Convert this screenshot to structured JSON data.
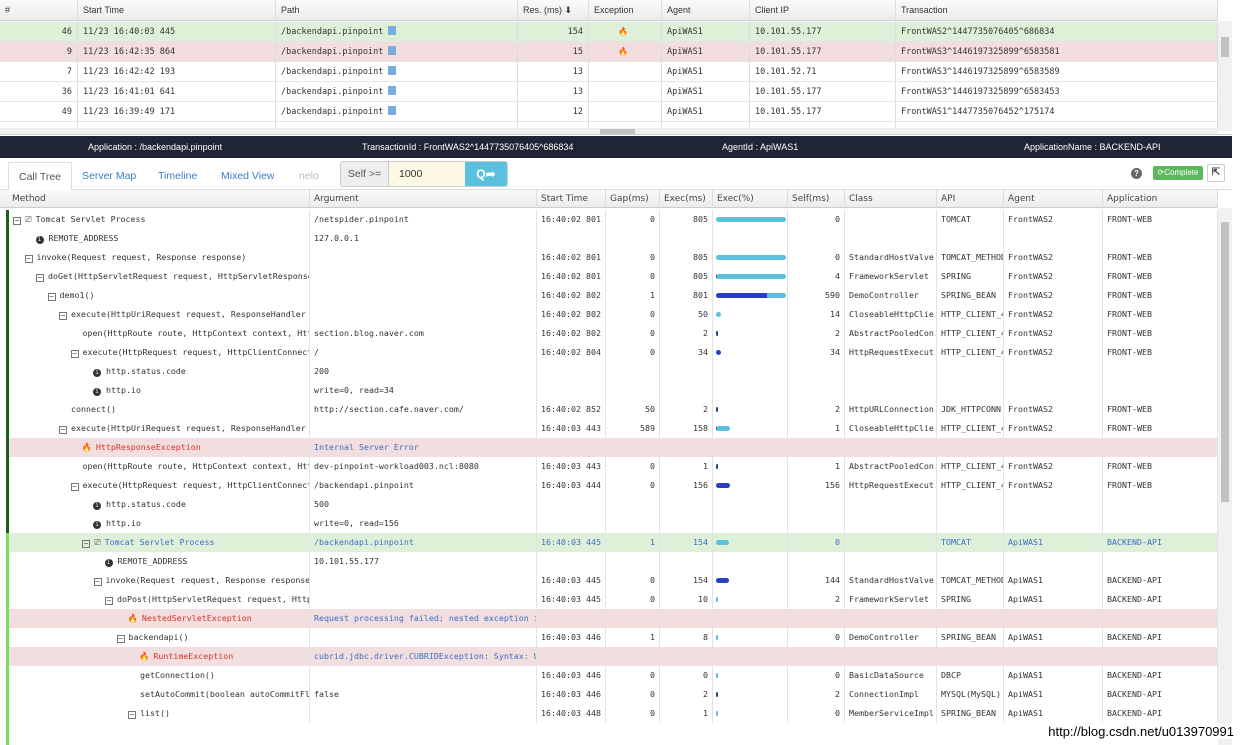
{
  "transactions": {
    "columns": [
      "#",
      "Start Time",
      "Path",
      "Res. (ms) ⬇",
      "Exception",
      "Agent",
      "Client IP",
      "Transaction"
    ],
    "rows": [
      {
        "num": "46",
        "start": "11/23 16:40:03 445",
        "path": "/backendapi.pinpoint",
        "res": "154",
        "exception": true,
        "agent": "ApiWAS1",
        "ip": "10.101.55.177",
        "tx": "FrontWAS2^1447735076405^686834",
        "state": "selected"
      },
      {
        "num": "9",
        "start": "11/23 16:42:35 864",
        "path": "/backendapi.pinpoint",
        "res": "15",
        "exception": true,
        "agent": "ApiWAS1",
        "ip": "10.101.55.177",
        "tx": "FrontWAS3^1446197325899^6583581",
        "state": "error"
      },
      {
        "num": "7",
        "start": "11/23 16:42:42 193",
        "path": "/backendapi.pinpoint",
        "res": "13",
        "exception": false,
        "agent": "ApiWAS1",
        "ip": "10.101.52.71",
        "tx": "FrontWAS3^1446197325899^6583589",
        "state": ""
      },
      {
        "num": "36",
        "start": "11/23 16:41:01 641",
        "path": "/backendapi.pinpoint",
        "res": "13",
        "exception": false,
        "agent": "ApiWAS1",
        "ip": "10.101.55.177",
        "tx": "FrontWAS3^1446197325899^6583453",
        "state": ""
      },
      {
        "num": "49",
        "start": "11/23 16:39:49 171",
        "path": "/backendapi.pinpoint",
        "res": "12",
        "exception": false,
        "agent": "ApiWAS1",
        "ip": "10.101.55.177",
        "tx": "FrontWAS1^1447735076452^175174",
        "state": ""
      }
    ]
  },
  "info_bar": {
    "application": "Application : /backendapi.pinpoint",
    "transaction_id": "TransactionId : FrontWAS2^1447735076405^686834",
    "agent_id": "AgentId : ApiWAS1",
    "application_name": "ApplicationName : BACKEND-API"
  },
  "tabs": [
    {
      "label": "Call Tree",
      "active": true
    },
    {
      "label": "Server Map"
    },
    {
      "label": "Timeline"
    },
    {
      "label": "Mixed View"
    },
    {
      "label": "nelo"
    }
  ],
  "filter": {
    "label": "Self >=",
    "value": "1000",
    "search_icon": "Q➦"
  },
  "toolbar": {
    "help_icon": "?",
    "complete_label": "⟳Complete",
    "open_icon": "⇱"
  },
  "call_tree": {
    "columns": [
      "Method",
      "Argument",
      "Start Time",
      "Gap(ms)",
      "Exec(ms)",
      "Exec(%)",
      "Self(ms)",
      "Class",
      "API",
      "Agent",
      "Application"
    ],
    "total_exec": 805,
    "colors": {
      "exec_bar": "#5bc0de",
      "self_bar": "#2a3fbf",
      "front_border": "#1a5e1a",
      "backend_border": "#7ddc5c"
    },
    "rows": [
      {
        "lvl": 0,
        "icon": "toggle-server",
        "method": "Tomcat Servlet Process",
        "arg": "/netspider.pinpoint",
        "start": "16:40:02 801",
        "gap": "0",
        "exec": "805",
        "self": "0",
        "cls": "",
        "api": "TOMCAT",
        "agent": "FrontWAS2",
        "app": "FRONT-WEB"
      },
      {
        "lvl": 1,
        "icon": "info",
        "method": "REMOTE_ADDRESS",
        "arg": "127.0.0.1"
      },
      {
        "lvl": 1,
        "icon": "toggle",
        "method": "invoke(Request request, Response response)",
        "arg": "",
        "start": "16:40:02 801",
        "gap": "0",
        "exec": "805",
        "self": "0",
        "cls": "StandardHostValve",
        "api": "TOMCAT_METHOD",
        "agent": "FrontWAS2",
        "app": "FRONT-WEB"
      },
      {
        "lvl": 2,
        "icon": "toggle",
        "method": "doGet(HttpServletRequest request, HttpServletResponse res",
        "arg": "",
        "start": "16:40:02 801",
        "gap": "0",
        "exec": "805",
        "self": "4",
        "cls": "FrameworkServlet",
        "api": "SPRING",
        "agent": "FrontWAS2",
        "app": "FRONT-WEB"
      },
      {
        "lvl": 3,
        "icon": "toggle",
        "method": "demo1()",
        "arg": "",
        "start": "16:40:02 802",
        "gap": "1",
        "exec": "801",
        "self": "590",
        "cls": "DemoController",
        "api": "SPRING_BEAN",
        "agent": "FrontWAS2",
        "app": "FRONT-WEB"
      },
      {
        "lvl": 4,
        "icon": "toggle",
        "method": "execute(HttpUriRequest request, ResponseHandler resp",
        "arg": "",
        "start": "16:40:02 802",
        "gap": "0",
        "exec": "50",
        "self": "14",
        "cls": "CloseableHttpClie..",
        "api": "HTTP_CLIENT_4",
        "agent": "FrontWAS2",
        "app": "FRONT-WEB"
      },
      {
        "lvl": 5,
        "icon": "none",
        "method": "open(HttpRoute route, HttpContext context, HttpPa",
        "arg": "section.blog.naver.com",
        "start": "16:40:02 802",
        "gap": "0",
        "exec": "2",
        "self": "2",
        "cls": "AbstractPooledCon..",
        "api": "HTTP_CLIENT_4",
        "agent": "FrontWAS2",
        "app": "FRONT-WEB"
      },
      {
        "lvl": 5,
        "icon": "toggle",
        "method": "execute(HttpRequest request, HttpClientConnection",
        "arg": "/",
        "start": "16:40:02 804",
        "gap": "0",
        "exec": "34",
        "self": "34",
        "cls": "HttpRequestExecut..",
        "api": "HTTP_CLIENT_4",
        "agent": "FrontWAS2",
        "app": "FRONT-WEB"
      },
      {
        "lvl": 6,
        "icon": "info",
        "method": "http.status.code",
        "arg": "200"
      },
      {
        "lvl": 6,
        "icon": "info",
        "method": "http.io",
        "arg": "write=0, read=34"
      },
      {
        "lvl": 4,
        "icon": "none",
        "method": "connect()",
        "arg": "http://section.cafe.naver.com/",
        "start": "16:40:02 852",
        "gap": "50",
        "exec": "2",
        "self": "2",
        "cls": "HttpURLConnection",
        "api": "JDK_HTTPCONN..",
        "agent": "FrontWAS2",
        "app": "FRONT-WEB"
      },
      {
        "lvl": 4,
        "icon": "toggle",
        "method": "execute(HttpUriRequest request, ResponseHandler resp",
        "arg": "",
        "start": "16:40:03 443",
        "gap": "589",
        "exec": "158",
        "self": "1",
        "cls": "CloseableHttpClie..",
        "api": "HTTP_CLIENT_4",
        "agent": "FrontWAS2",
        "app": "FRONT-WEB"
      },
      {
        "lvl": 5,
        "icon": "exception",
        "method": "HttpResponseException",
        "arg": "Internal Server Error",
        "state": "exc"
      },
      {
        "lvl": 5,
        "icon": "none",
        "method": "open(HttpRoute route, HttpContext context, HttpPa",
        "arg": "dev-pinpoint-workload003.ncl:8080",
        "start": "16:40:03 443",
        "gap": "0",
        "exec": "1",
        "self": "1",
        "cls": "AbstractPooledCon..",
        "api": "HTTP_CLIENT_4",
        "agent": "FrontWAS2",
        "app": "FRONT-WEB"
      },
      {
        "lvl": 5,
        "icon": "toggle",
        "method": "execute(HttpRequest request, HttpClientConnection",
        "arg": "/backendapi.pinpoint",
        "start": "16:40:03 444",
        "gap": "0",
        "exec": "156",
        "self": "156",
        "cls": "HttpRequestExecut..",
        "api": "HTTP_CLIENT_4",
        "agent": "FrontWAS2",
        "app": "FRONT-WEB"
      },
      {
        "lvl": 6,
        "icon": "info",
        "method": "http.status.code",
        "arg": "500"
      },
      {
        "lvl": 6,
        "icon": "info",
        "method": "http.io",
        "arg": "write=0, read=156"
      },
      {
        "lvl": 6,
        "icon": "toggle-server",
        "method": "Tomcat Servlet Process",
        "arg": "/backendapi.pinpoint",
        "start": "16:40:03 445",
        "gap": "1",
        "exec": "154",
        "self": "0",
        "cls": "",
        "api": "TOMCAT",
        "agent": "ApiWAS1",
        "app": "BACKEND-API",
        "state": "green"
      },
      {
        "lvl": 7,
        "icon": "info",
        "method": "REMOTE_ADDRESS",
        "arg": "10.101.55.177"
      },
      {
        "lvl": 7,
        "icon": "toggle",
        "method": "invoke(Request request, Response response)",
        "arg": "",
        "start": "16:40:03 445",
        "gap": "0",
        "exec": "154",
        "self": "144",
        "cls": "StandardHostValve",
        "api": "TOMCAT_METHOD",
        "agent": "ApiWAS1",
        "app": "BACKEND-API"
      },
      {
        "lvl": 8,
        "icon": "toggle",
        "method": "doPost(HttpServletRequest request, HttpSer",
        "arg": "",
        "start": "16:40:03 445",
        "gap": "0",
        "exec": "10",
        "self": "2",
        "cls": "FrameworkServlet",
        "api": "SPRING",
        "agent": "ApiWAS1",
        "app": "BACKEND-API"
      },
      {
        "lvl": 9,
        "icon": "exception",
        "method": "NestedServletException",
        "arg": "Request processing failed; nested exception is ja",
        "state": "exc"
      },
      {
        "lvl": 9,
        "icon": "toggle",
        "method": "backendapi()",
        "arg": "",
        "start": "16:40:03 446",
        "gap": "1",
        "exec": "8",
        "self": "0",
        "cls": "DemoController",
        "api": "SPRING_BEAN",
        "agent": "ApiWAS1",
        "app": "BACKEND-API"
      },
      {
        "lvl": 10,
        "icon": "exception",
        "method": "RuntimeException",
        "arg": "cubrid.jdbc.driver.CUBRIDException: Syntax: Unknc",
        "state": "exc"
      },
      {
        "lvl": 10,
        "icon": "none",
        "method": "getConnection()",
        "arg": "",
        "start": "16:40:03 446",
        "gap": "0",
        "exec": "0",
        "self": "0",
        "cls": "BasicDataSource",
        "api": "DBCP",
        "agent": "ApiWAS1",
        "app": "BACKEND-API"
      },
      {
        "lvl": 10,
        "icon": "none",
        "method": "setAutoCommit(boolean autoCommitFlag)",
        "arg": "false",
        "start": "16:40:03 446",
        "gap": "0",
        "exec": "2",
        "self": "2",
        "cls": "ConnectionImpl",
        "api": "MYSQL(MySQL)",
        "agent": "ApiWAS1",
        "app": "BACKEND-API"
      },
      {
        "lvl": 10,
        "icon": "toggle",
        "method": "list()",
        "arg": "",
        "start": "16:40:03 448",
        "gap": "0",
        "exec": "1",
        "self": "0",
        "cls": "MemberServiceImpl",
        "api": "SPRING_BEAN",
        "agent": "ApiWAS1",
        "app": "BACKEND-API"
      }
    ]
  },
  "watermark": "http://blog.csdn.net/u013970991"
}
